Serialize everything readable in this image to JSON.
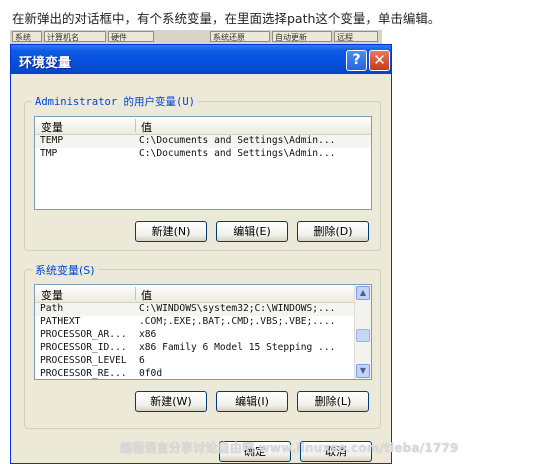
{
  "caption": "在新弹出的对话框中，有个系统变量，在里面选择path这个变量，单击编辑。",
  "behind_window": [
    "系统",
    "计算机名",
    "硬件",
    "系统还原",
    "自动更新",
    "远程"
  ],
  "dialog": {
    "title": "环境变量",
    "help_glyph": "?",
    "close_glyph": "✕",
    "user_vars": {
      "label": "Administrator 的用户变量(U)",
      "col_var": "变量",
      "col_val": "值",
      "rows": [
        {
          "name": "TEMP",
          "value": "C:\\Documents and Settings\\Admin..."
        },
        {
          "name": "TMP",
          "value": "C:\\Documents and Settings\\Admin..."
        }
      ],
      "buttons": {
        "new": "新建(N)",
        "edit": "编辑(E)",
        "delete": "删除(D)"
      }
    },
    "system_vars": {
      "label": "系统变量(S)",
      "col_var": "变量",
      "col_val": "值",
      "rows": [
        {
          "name": "Path",
          "value": "C:\\WINDOWS\\system32;C:\\WINDOWS;..."
        },
        {
          "name": "PATHEXT",
          "value": ".COM;.EXE;.BAT;.CMD;.VBS;.VBE;...."
        },
        {
          "name": "PROCESSOR_AR...",
          "value": "x86"
        },
        {
          "name": "PROCESSOR_ID...",
          "value": "x86 Family 6 Model 15 Stepping ..."
        },
        {
          "name": "PROCESSOR_LEVEL",
          "value": "6"
        },
        {
          "name": "PROCESSOR_RE...",
          "value": "0f0d"
        }
      ],
      "buttons": {
        "new": "新建(W)",
        "edit": "编辑(I)",
        "delete": "删除(L)"
      }
    },
    "footer": {
      "ok": "确定",
      "cancel": "取消"
    }
  },
  "watermark": "编程语言分享讨论自由吧 www.linuxso.com/tieba/1779"
}
